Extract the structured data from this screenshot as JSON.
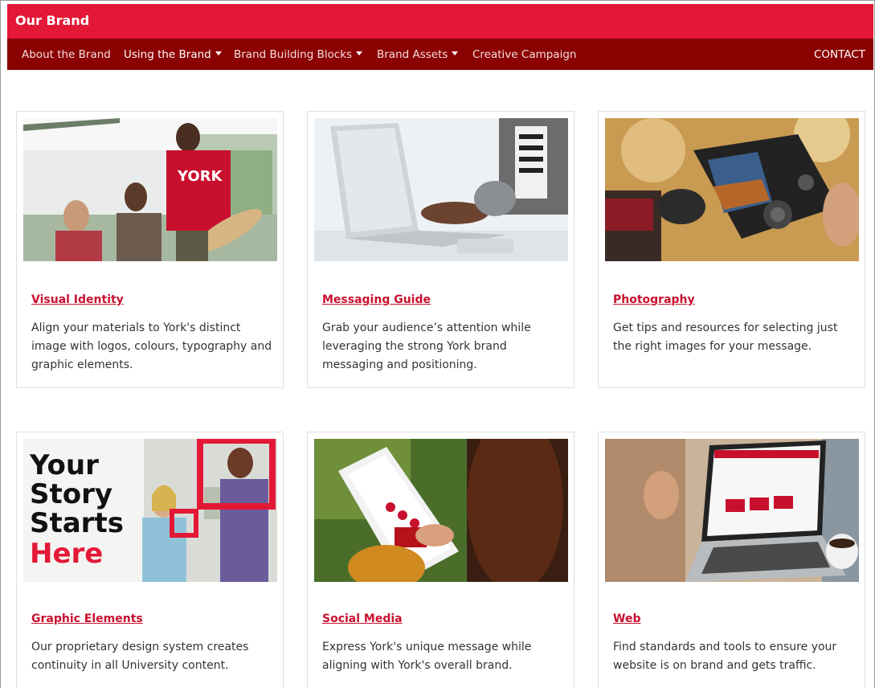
{
  "header": {
    "brand_title": "Our Brand"
  },
  "nav": {
    "items": [
      {
        "label": "About the Brand",
        "dropdown": false
      },
      {
        "label": "Using the Brand",
        "dropdown": true
      },
      {
        "label": "Brand Building Blocks",
        "dropdown": true
      },
      {
        "label": "Brand Assets",
        "dropdown": true
      },
      {
        "label": "Creative Campaign",
        "dropdown": false
      }
    ],
    "contact": "CONTACT"
  },
  "colors": {
    "brand_red": "#e31837",
    "nav_dark_red": "#8b0000",
    "link_red": "#c8102e"
  },
  "cards": [
    {
      "title": "Visual Identity",
      "description": "Align your materials to York's distinct image with logos, colours, typography and graphic elements.",
      "image": "students-photo"
    },
    {
      "title": "Messaging Guide",
      "description": "Grab your audience’s attention while leveraging the strong York brand messaging and positioning.",
      "image": "laptop-typing-photo"
    },
    {
      "title": "Photography",
      "description": "Get tips and resources for selecting just the right images for your message.",
      "image": "camera-photo"
    },
    {
      "title": "Graphic Elements",
      "description": "Our proprietary design system creates continuity in all University content.",
      "image": "your-story-graphic",
      "image_text": [
        "Your",
        "Story",
        "Starts",
        "Here"
      ]
    },
    {
      "title": "Social Media",
      "description": "Express York's unique message while aligning with York's overall brand.",
      "image": "phone-instagram-photo"
    },
    {
      "title": "Web",
      "description": "Find standards and tools to ensure your website is on brand and gets traffic.",
      "image": "laptop-website-photo"
    }
  ]
}
